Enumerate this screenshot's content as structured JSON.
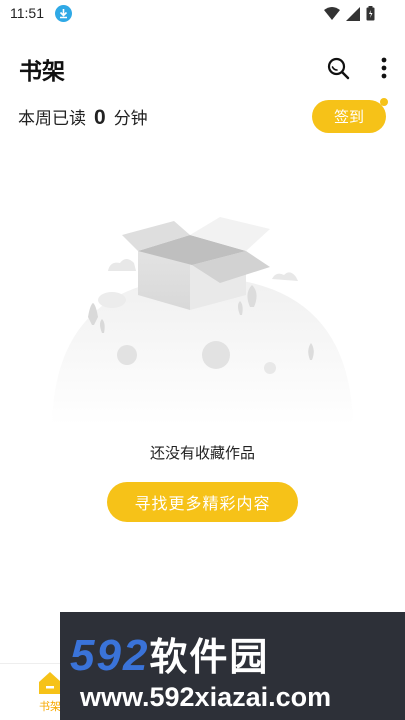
{
  "status_bar": {
    "time": "11:51",
    "icons": [
      "download-icon",
      "wifi-icon",
      "signal-icon",
      "battery-icon"
    ]
  },
  "header": {
    "title": "书架",
    "actions": [
      "search-icon",
      "more-icon"
    ]
  },
  "reading_stats": {
    "prefix": "本周已读",
    "minutes": "0",
    "unit": "分钟"
  },
  "checkin": {
    "label": "签到",
    "has_notification_dot": true
  },
  "empty_state": {
    "illustration": "empty-box-icon",
    "message": "还没有收藏作品",
    "button_label": "寻找更多精彩内容"
  },
  "bottom_nav": {
    "tabs": [
      {
        "icon": "home-icon",
        "label": "书架",
        "active": true
      }
    ]
  },
  "watermark": {
    "brand_number": "592",
    "brand_text": "软件园",
    "url": "www.592xiazai.com"
  },
  "colors": {
    "accent": "#f6c218",
    "watermark_bg": "#2d3038",
    "watermark_blue": "#3a73d9"
  }
}
